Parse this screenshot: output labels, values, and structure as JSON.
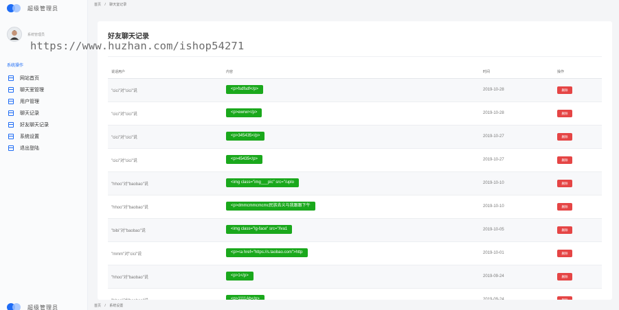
{
  "brand": {
    "name": "超级管理员"
  },
  "user": {
    "role": "系统管理员"
  },
  "sidebar": {
    "heading": "系统操作",
    "items": [
      {
        "label": "网站首页",
        "icon": "window-icon"
      },
      {
        "label": "聊天室管理",
        "icon": "window-icon"
      },
      {
        "label": "用户管理",
        "icon": "window-icon"
      },
      {
        "label": "聊天记录",
        "icon": "window-icon"
      },
      {
        "label": "好友聊天记录",
        "icon": "window-icon"
      },
      {
        "label": "系统设置",
        "icon": "window-icon"
      },
      {
        "label": "退出登陆",
        "icon": "window-icon"
      }
    ]
  },
  "breadcrumb": {
    "home": "首页",
    "sep": "/",
    "current": "聊天室记录"
  },
  "breadcrumb_bottom": {
    "home": "首页",
    "sep": "/",
    "current": "系统设置"
  },
  "watermark": "https://www.huzhan.com/ishop54271",
  "page": {
    "title": "好友聊天记录"
  },
  "table": {
    "headers": {
      "speaker": "说话用户",
      "content": "内容",
      "time": "时间",
      "ops": "操作"
    },
    "delete_label": "删除",
    "rows": [
      {
        "speaker": "\"cici\"对\"cici\"说",
        "content": "<p>fsdfsdf</p>",
        "time": "2019-10-28"
      },
      {
        "speaker": "\"cici\"对\"cici\"说",
        "content": "<p>ewrwr</p>",
        "time": "2019-10-28"
      },
      {
        "speaker": "\"cici\"对\"cici\"说",
        "content": "<p>345435</p>",
        "time": "2019-10-27"
      },
      {
        "speaker": "\"cici\"对\"cici\"说",
        "content": "<p>45435</p>",
        "time": "2019-10-27"
      },
      {
        "speaker": "\"hhoo\"对\"baobao\"说",
        "content": "<img class=\"img___pic\" src=\"/uplo",
        "time": "2019-10-10"
      },
      {
        "speaker": "\"hhoo\"对\"baobao\"说",
        "content": "<p>dmmcmmcmcmc民族去义与我跟跟下午",
        "time": "2019-10-10"
      },
      {
        "speaker": "\"bibi\"对\"baobao\"说",
        "content": "<img class=\"lg-face\" src=\"/lva1",
        "time": "2019-10-05"
      },
      {
        "speaker": "\"mmm\"对\"cici\"说",
        "content": "<p><a href=\"https://s.taobao.com\">http",
        "time": "2019-10-01"
      },
      {
        "speaker": "\"hhoo\"对\"baobao\"说",
        "content": "<p>1</p>",
        "time": "2019-09-24"
      },
      {
        "speaker": "\"hhoo\"对\"baobao\"说",
        "content": "<p>1111Ab</p>",
        "time": "2019-09-24"
      }
    ]
  },
  "colors": {
    "accent": "#1e6cf5",
    "content_pill": "#1aa81c",
    "delete_button": "#e54545"
  }
}
